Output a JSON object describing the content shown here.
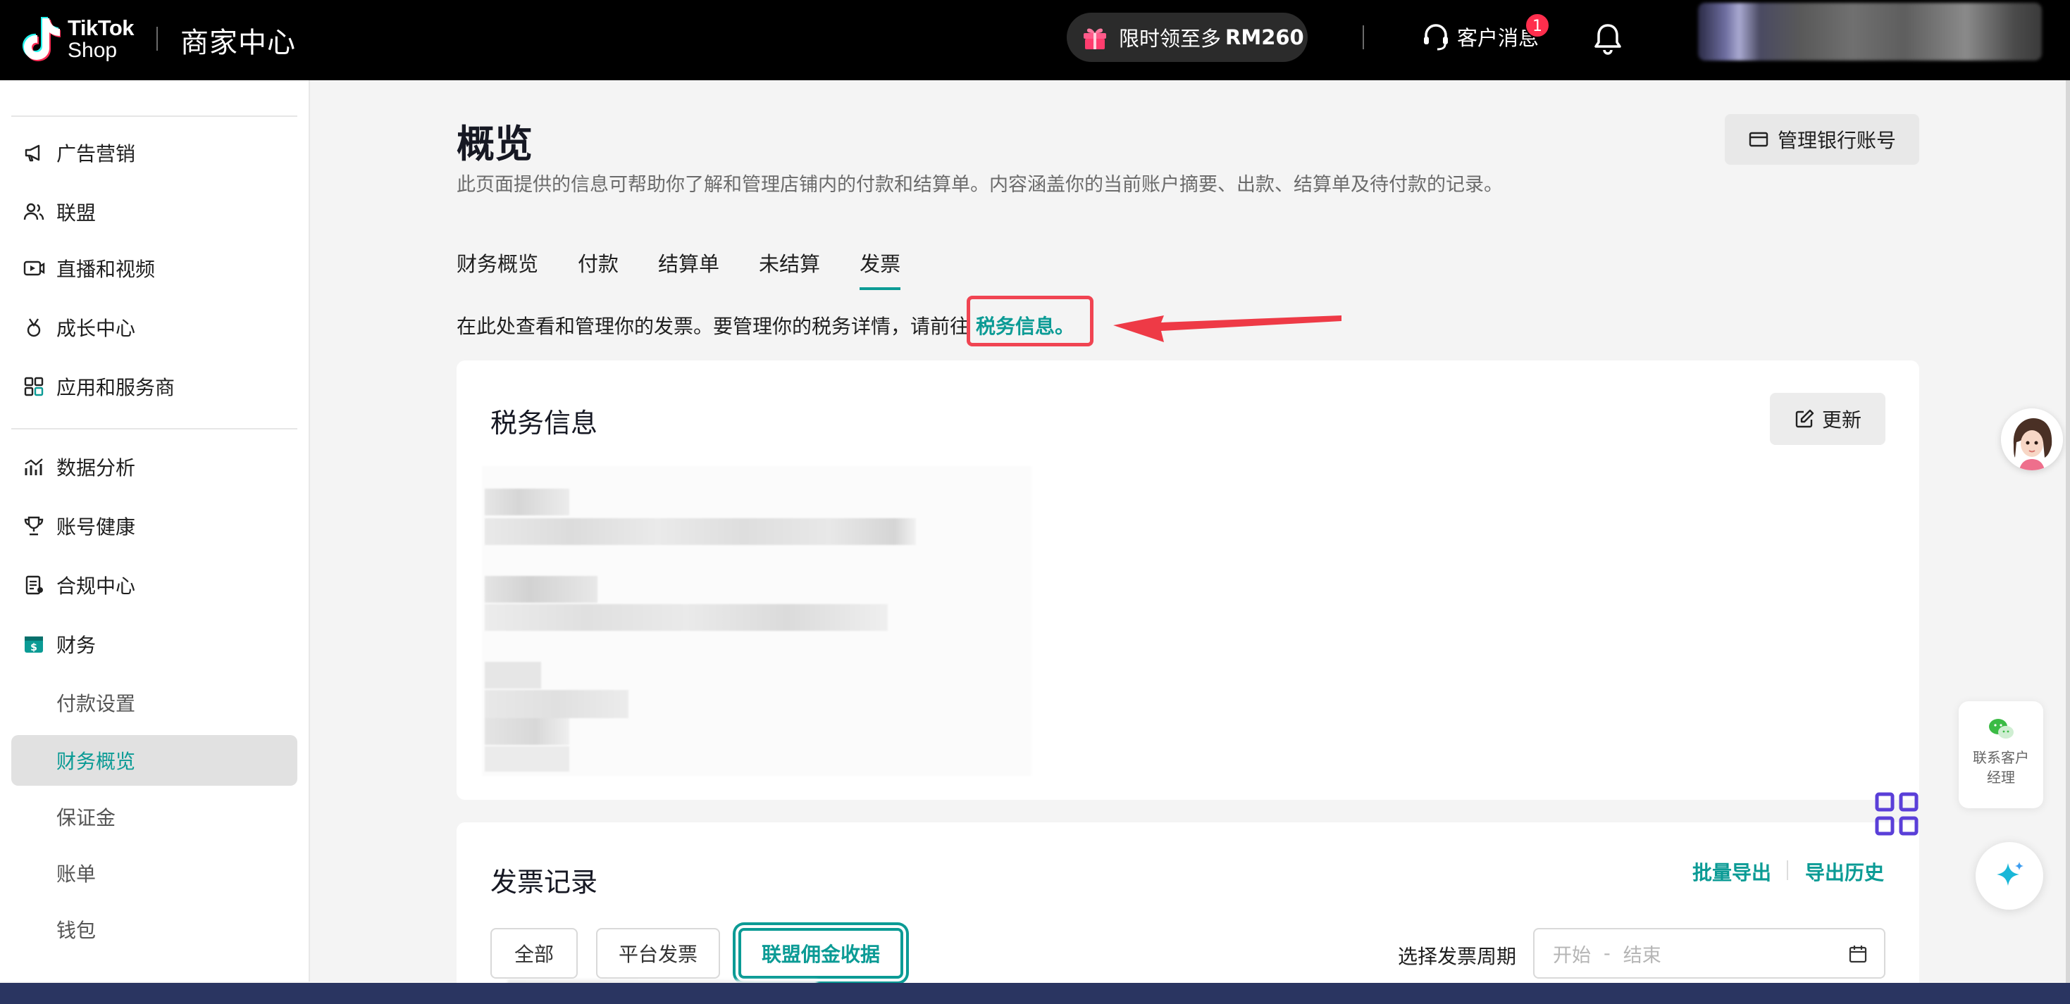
{
  "header": {
    "logo_line1": "TikTok",
    "logo_line2": "Shop",
    "title": "商家中心",
    "promo_prefix": "限时领至多",
    "promo_amount": "RM260",
    "customer_service": "客户消息",
    "cs_badge_count": "1"
  },
  "sidebar": {
    "groups": [
      {
        "label": "广告营销",
        "icon": "megaphone-icon"
      },
      {
        "label": "联盟",
        "icon": "users-icon"
      },
      {
        "label": "直播和视频",
        "icon": "video-icon"
      },
      {
        "label": "成长中心",
        "icon": "medal-icon"
      },
      {
        "label": "应用和服务商",
        "icon": "apps-icon"
      },
      {
        "label": "数据分析",
        "icon": "chart-icon"
      },
      {
        "label": "账号健康",
        "icon": "trophy-icon"
      },
      {
        "label": "合规中心",
        "icon": "compliance-icon"
      },
      {
        "label": "财务",
        "icon": "finance-icon"
      }
    ],
    "finance_subitems": [
      "付款设置",
      "财务概览",
      "保证金",
      "账单",
      "钱包"
    ],
    "active_subitem": "财务概览"
  },
  "main": {
    "title": "概览",
    "description": "此页面提供的信息可帮助你了解和管理店铺内的付款和结算单。内容涵盖你的当前账户摘要、出款、结算单及待付款的记录。",
    "bank_button": "管理银行账号",
    "tabs": [
      "财务概览",
      "付款",
      "结算单",
      "未结算",
      "发票"
    ],
    "active_tab": "发票",
    "info_text": "在此处查看和管理你的发票。要管理你的税务详情，请前往",
    "info_link": "税务信息。",
    "tax_card": {
      "title": "税务信息",
      "update_button": "更新"
    },
    "invoice_card": {
      "title": "发票记录",
      "bulk_export": "批量导出",
      "export_history": "导出历史",
      "filters": [
        "全部",
        "平台发票",
        "联盟佣金收据"
      ],
      "active_filter": "联盟佣金收据",
      "period_label": "选择发票周期",
      "date_start_placeholder": "开始",
      "date_sep": "-",
      "date_end_placeholder": "结束"
    }
  },
  "floating": {
    "contact_manager": "联系客户经理"
  },
  "colors": {
    "accent": "#0b9b95",
    "annotation_red": "#f04452",
    "topbar": "#000000"
  }
}
